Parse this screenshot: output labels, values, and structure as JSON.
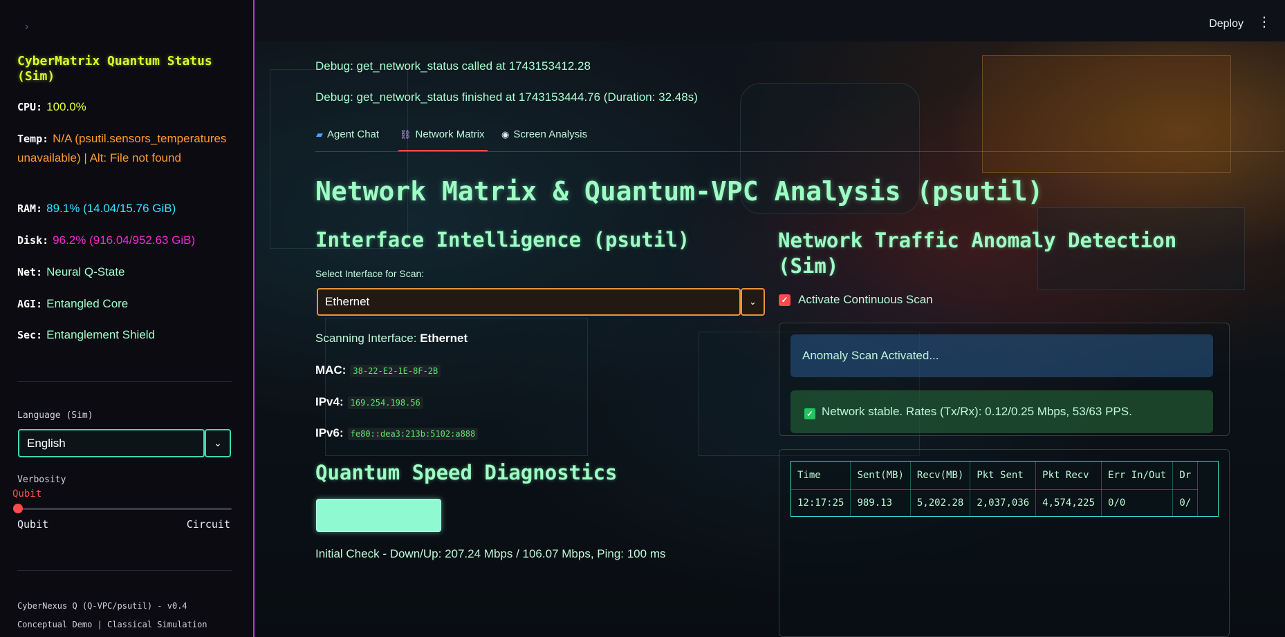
{
  "sidebar": {
    "collapse_icon": "chevron-right-icon",
    "title": "CyberMatrix Quantum Status (Sim)",
    "stats": {
      "cpu": {
        "label": "CPU:",
        "value": "100.0%"
      },
      "temp": {
        "label": "Temp:",
        "value": "N/A (psutil.sensors_temperatures unavailable) | Alt: File not found"
      },
      "ram": {
        "label": "RAM:",
        "value": "89.1% (14.04/15.76 GiB)"
      },
      "disk": {
        "label": "Disk:",
        "value": "96.2% (916.04/952.63 GiB)"
      },
      "net": {
        "label": "Net:",
        "value": "Neural Q-State"
      },
      "agi": {
        "label": "AGI:",
        "value": "Entangled Core"
      },
      "sec": {
        "label": "Sec:",
        "value": "Entanglement Shield"
      }
    },
    "language": {
      "label": "Language (Sim)",
      "selected": "English"
    },
    "verbosity": {
      "label": "Verbosity",
      "value": "Qubit",
      "min_label": "Qubit",
      "max_label": "Circuit",
      "level": 0
    },
    "footer": [
      "CyberNexus Q (Q-VPC/psutil) - v0.4",
      "Conceptual Demo | Classical Simulation"
    ]
  },
  "topbar": {
    "deploy_label": "Deploy",
    "menu_icon": "kebab-menu-icon"
  },
  "debug": [
    "Debug: get_network_status called at 1743153412.28",
    "Debug: get_network_status finished at 1743153444.76 (Duration: 32.48s)"
  ],
  "tabs": [
    {
      "label": "Agent Chat",
      "icon": "chat-icon",
      "active": false
    },
    {
      "label": "Network Matrix",
      "icon": "network-icon",
      "active": true
    },
    {
      "label": "Screen Analysis",
      "icon": "eye-icon",
      "active": false
    }
  ],
  "main": {
    "title": "Network Matrix & Quantum-VPC Analysis (psutil)",
    "interface": {
      "heading": "Interface Intelligence (psutil)",
      "select_label": "Select Interface for Scan:",
      "selected": "Ethernet",
      "scanning_label": "Scanning Interface:",
      "scanning_value": "Ethernet",
      "mac_label": "MAC:",
      "mac": "38-22-E2-1E-8F-2B",
      "ipv4_label": "IPv4:",
      "ipv4": "169.254.198.56",
      "ipv6_label": "IPv6:",
      "ipv6": "fe80::dea3:213b:5102:a888"
    },
    "speed": {
      "heading": "Quantum Speed Diagnostics",
      "result": "Initial Check - Down/Up: 207.24 Mbps / 106.07 Mbps, Ping: 100 ms"
    },
    "anomaly": {
      "heading": "Network Traffic Anomaly Detection (Sim)",
      "checkbox_label": "Activate Continuous Scan",
      "checked": true,
      "info_message": "Anomaly Scan Activated...",
      "success_message": "Network stable. Rates (Tx/Rx): 0.12/0.25 Mbps, 53/63 PPS."
    },
    "table": {
      "columns": [
        "Time",
        "Sent(MB)",
        "Recv(MB)",
        "Pkt Sent",
        "Pkt Recv",
        "Err In/Out",
        "Dr"
      ],
      "rows": [
        [
          "12:17:25",
          "989.13",
          "5,202.28",
          "2,037,036",
          "4,574,225",
          "0/0",
          "0/"
        ]
      ]
    }
  },
  "colors": {
    "accent": "#ff4b4b",
    "heading": "#9effc4",
    "sidebar_border": "#c03ad8",
    "sidebar_title": "#d7ff2a"
  }
}
